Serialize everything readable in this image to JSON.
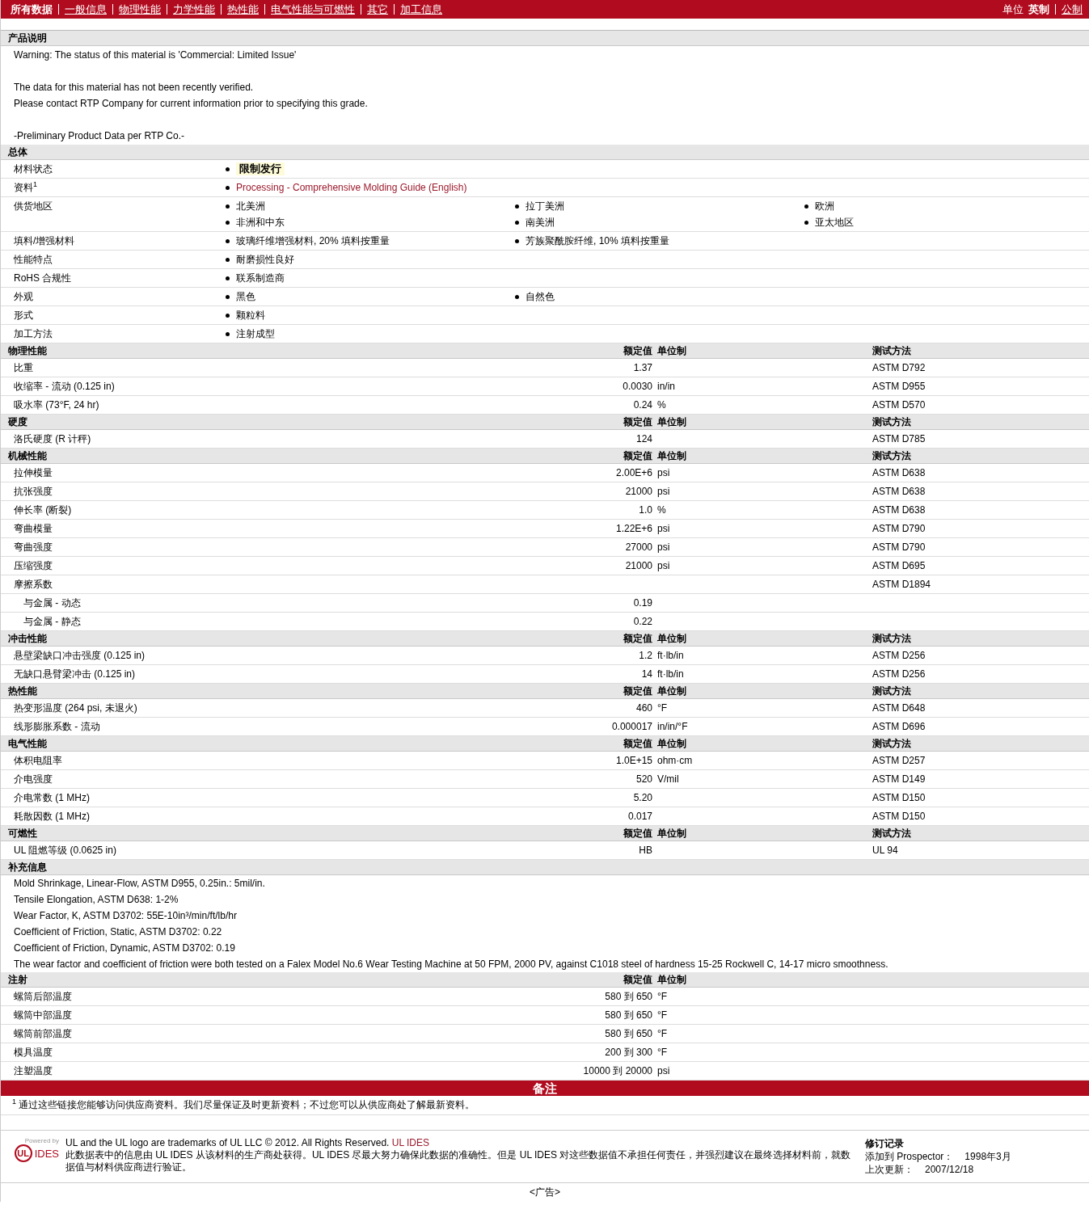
{
  "nav": {
    "tabs": [
      {
        "label": "所有数据",
        "selected": true
      },
      {
        "label": "一般信息",
        "selected": false
      },
      {
        "label": "物理性能",
        "selected": false
      },
      {
        "label": "力学性能",
        "selected": false
      },
      {
        "label": "热性能",
        "selected": false
      },
      {
        "label": "电气性能与可燃性",
        "selected": false
      },
      {
        "label": "其它",
        "selected": false
      },
      {
        "label": "加工信息",
        "selected": false
      }
    ],
    "units_label": "单位",
    "units": [
      {
        "label": "英制",
        "selected": true
      },
      {
        "label": "公制",
        "selected": false
      }
    ]
  },
  "product_description": {
    "title": "产品说明",
    "paragraphs": [
      [
        "Warning: The status of this material is 'Commercial: Limited Issue'"
      ],
      [
        "The data for this material has not been recently verified.",
        "Please contact RTP Company for current information prior to specifying this grade."
      ],
      [
        "-Preliminary Product Data per RTP Co.-"
      ]
    ]
  },
  "general": {
    "title": "总体",
    "rows": [
      {
        "label": "材料状态",
        "items": [
          {
            "text": "限制发行",
            "kind": "status"
          }
        ]
      },
      {
        "label": "资料",
        "sup": "1",
        "items": [
          {
            "text": "Processing - Comprehensive Molding Guide (English)",
            "kind": "link"
          }
        ]
      },
      {
        "label": "供货地区",
        "items": [
          {
            "text": "北美洲",
            "kind": "text"
          },
          {
            "text": "拉丁美洲",
            "kind": "text"
          },
          {
            "text": "欧洲",
            "kind": "text"
          },
          {
            "text": "非洲和中东",
            "kind": "text"
          },
          {
            "text": "南美洲",
            "kind": "text"
          },
          {
            "text": "亚太地区",
            "kind": "text"
          }
        ]
      },
      {
        "label": "填料/增强材料",
        "items": [
          {
            "text": "玻璃纤维增强材料, 20% 填料按重量",
            "kind": "text"
          },
          {
            "text": "芳族聚酰胺纤维, 10% 填料按重量",
            "kind": "text"
          }
        ]
      },
      {
        "label": "性能特点",
        "items": [
          {
            "text": "耐磨损性良好",
            "kind": "text"
          }
        ]
      },
      {
        "label": "RoHS 合规性",
        "items": [
          {
            "text": "联系制造商",
            "kind": "text"
          }
        ]
      },
      {
        "label": "外观",
        "items": [
          {
            "text": "黑色",
            "kind": "text"
          },
          {
            "text": "自然色",
            "kind": "text"
          }
        ]
      },
      {
        "label": "形式",
        "items": [
          {
            "text": "颗粒料",
            "kind": "text"
          }
        ]
      },
      {
        "label": "加工方法",
        "items": [
          {
            "text": "注射成型",
            "kind": "text"
          }
        ]
      }
    ]
  },
  "property_sections": [
    {
      "title": "物理性能",
      "value_header": "额定值",
      "unit_header": "单位制",
      "method_header": "测试方法",
      "rows": [
        {
          "name": "比重",
          "value": "1.37",
          "method": "ASTM D792"
        },
        {
          "name": "收缩率  - 流动  (0.125 in)",
          "value": "0.0030",
          "unit": "in/in",
          "method": "ASTM D955"
        },
        {
          "name": "吸水率  (73°F, 24 hr)",
          "value": "0.24",
          "unit": "%",
          "method": "ASTM D570"
        }
      ]
    },
    {
      "title": "硬度",
      "value_header": "额定值",
      "unit_header": "单位制",
      "method_header": "测试方法",
      "rows": [
        {
          "name": "洛氏硬度  (R 计秤)",
          "value": "124",
          "method": "ASTM D785"
        }
      ]
    },
    {
      "title": "机械性能",
      "value_header": "额定值",
      "unit_header": "单位制",
      "method_header": "测试方法",
      "rows": [
        {
          "name": "拉伸模量",
          "value": "2.00E+6",
          "unit": "psi",
          "method": "ASTM D638"
        },
        {
          "name": "抗张强度",
          "value": "21000",
          "unit": "psi",
          "method": "ASTM D638"
        },
        {
          "name": "伸长率  (断裂)",
          "value": "1.0",
          "unit": "%",
          "method": "ASTM D638"
        },
        {
          "name": "弯曲模量",
          "value": "1.22E+6",
          "unit": "psi",
          "method": "ASTM D790"
        },
        {
          "name": "弯曲强度",
          "value": "27000",
          "unit": "psi",
          "method": "ASTM D790"
        },
        {
          "name": "压缩强度",
          "value": "21000",
          "unit": "psi",
          "method": "ASTM D695"
        },
        {
          "name": "摩擦系数",
          "method": "ASTM D1894",
          "children": [
            {
              "name": "与金属  - 动态",
              "value": "0.19"
            },
            {
              "name": "与金属  - 静态",
              "value": "0.22"
            }
          ]
        }
      ]
    },
    {
      "title": "冲击性能",
      "value_header": "额定值",
      "unit_header": "单位制",
      "method_header": "测试方法",
      "rows": [
        {
          "name": "悬壁梁缺口冲击强度  (0.125 in)",
          "value": "1.2",
          "unit": "ft·lb/in",
          "method": "ASTM D256"
        },
        {
          "name": "无缺口悬臂梁冲击  (0.125 in)",
          "value": "14",
          "unit": "ft·lb/in",
          "method": "ASTM D256"
        }
      ]
    },
    {
      "title": "热性能",
      "value_header": "额定值",
      "unit_header": "单位制",
      "method_header": "测试方法",
      "rows": [
        {
          "name": "热变形温度  (264 psi, 未退火)",
          "value": "460",
          "unit": "°F",
          "method": "ASTM D648"
        },
        {
          "name": "线形膨胀系数  - 流动",
          "value": "0.000017",
          "unit": "in/in/°F",
          "method": "ASTM D696"
        }
      ]
    },
    {
      "title": "电气性能",
      "value_header": "额定值",
      "unit_header": "单位制",
      "method_header": "测试方法",
      "rows": [
        {
          "name": "体积电阻率",
          "value": "1.0E+15",
          "unit": "ohm·cm",
          "method": "ASTM D257"
        },
        {
          "name": "介电强度",
          "value": "520",
          "unit": "V/mil",
          "method": "ASTM D149"
        },
        {
          "name": "介电常数  (1 MHz)",
          "value": "5.20",
          "method": "ASTM D150"
        },
        {
          "name": "耗散因数  (1 MHz)",
          "value": "0.017",
          "method": "ASTM D150"
        }
      ]
    },
    {
      "title": "可燃性",
      "value_header": "额定值",
      "unit_header": "单位制",
      "method_header": "测试方法",
      "rows": [
        {
          "name": "UL 阻燃等级  (0.0625 in)",
          "value": "HB",
          "method": "UL 94"
        }
      ]
    }
  ],
  "supplementary": {
    "title": "补充信息",
    "lines": [
      "Mold Shrinkage, Linear-Flow, ASTM D955, 0.25in.: 5mil/in.",
      "Tensile Elongation, ASTM D638: 1-2%",
      "Wear Factor, K, ASTM D3702: 55E-10in³/min/ft/lb/hr",
      "Coefficient of Friction, Static, ASTM D3702: 0.22",
      "Coefficient of Friction, Dynamic, ASTM D3702: 0.19",
      "The wear factor and coefficient of friction were both tested on a Falex Model No.6 Wear Testing Machine at 50 FPM, 2000 PV, against C1018 steel of hardness 15-25 Rockwell C, 14-17 micro smoothness."
    ]
  },
  "injection": {
    "title": "注射",
    "value_header": "额定值",
    "unit_header": "单位制",
    "rows": [
      {
        "name": "螺筒后部温度",
        "value": "580 到  650",
        "unit": "°F"
      },
      {
        "name": "螺筒中部温度",
        "value": "580 到  650",
        "unit": "°F"
      },
      {
        "name": "螺筒前部温度",
        "value": "580 到  650",
        "unit": "°F"
      },
      {
        "name": "模具温度",
        "value": "200 到  300",
        "unit": "°F"
      },
      {
        "name": "注塑温度",
        "value": "10000 到  20000",
        "unit": "psi"
      }
    ]
  },
  "notes": {
    "title": "备注",
    "footnotes": [
      {
        "mark": "1",
        "text": "通过这些链接您能够访问供应商资料。我们尽量保证及时更新资料；不过您可以从供应商处了解最新资料。"
      }
    ]
  },
  "footer": {
    "logo": {
      "powered_by": "Powered by",
      "mark": "UL",
      "name": "IDES"
    },
    "trademark": "UL and the UL logo are trademarks of UL LLC © 2012. All Rights Reserved.",
    "trademark_link": "UL IDES",
    "disclaimer": "此数据表中的信息由  UL IDES 从该材料的生产商处获得。UL IDES 尽最大努力确保此数据的准确性。但是  UL IDES 对这些数据值不承担任何责任，并强烈建议在最终选择材料前，就数据值与材料供应商进行验证。",
    "revision": {
      "title": "修订记录",
      "rows": [
        {
          "label": "添加到  Prospector：",
          "value": "1998年3月"
        },
        {
          "label": "上次更新：",
          "value": "2007/12/18"
        }
      ]
    }
  },
  "ad": "<广告>"
}
